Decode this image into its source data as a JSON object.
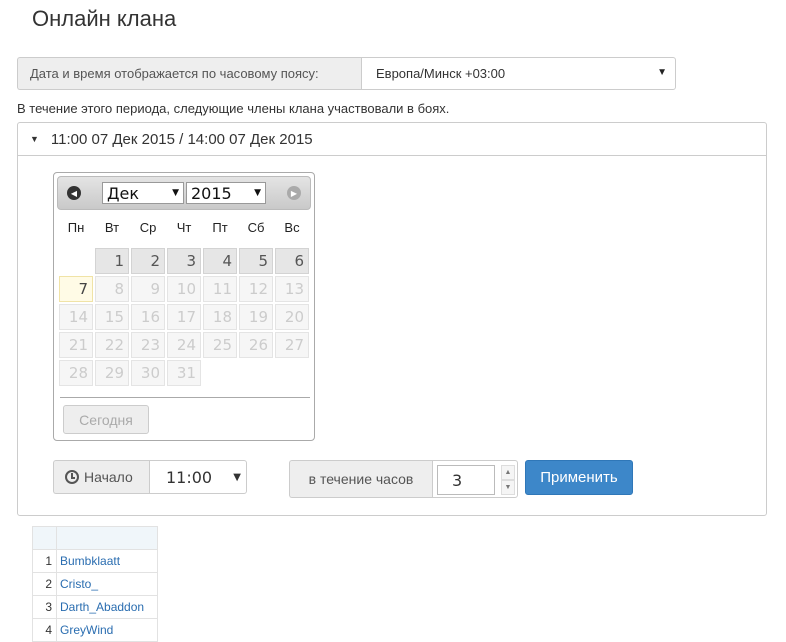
{
  "page": {
    "title": "Онлайн клана"
  },
  "timezone": {
    "label": "Дата и время отображается по часовому поясу:",
    "value": "Европа/Минск +03:00"
  },
  "period_text": "В течение этого периода, следующие члены клана участвовали в боях.",
  "panel": {
    "header": "11:00 07 Дек 2015 / 14:00 07 Дек 2015"
  },
  "datepicker": {
    "month": "Дек",
    "year": "2015",
    "weekdays": [
      "Пн",
      "Вт",
      "Ср",
      "Чт",
      "Пт",
      "Сб",
      "Вс"
    ],
    "today_button": "Сегодня",
    "days": [
      "",
      "1",
      "2",
      "3",
      "4",
      "5",
      "6",
      "7",
      "8",
      "9",
      "10",
      "11",
      "12",
      "13",
      "14",
      "15",
      "16",
      "17",
      "18",
      "19",
      "20",
      "21",
      "22",
      "23",
      "24",
      "25",
      "26",
      "27",
      "28",
      "29",
      "30",
      "31",
      "",
      "",
      ""
    ],
    "selectable_days": [
      "1",
      "2",
      "3",
      "4",
      "5",
      "6"
    ],
    "today_day": "7"
  },
  "start": {
    "label": "Начало",
    "value": "11:00"
  },
  "duration": {
    "label": "в течение часов",
    "value": "3"
  },
  "apply_button": "Применить",
  "members": [
    {
      "n": "1",
      "name": "Bumbklaatt"
    },
    {
      "n": "2",
      "name": "Cristo_"
    },
    {
      "n": "3",
      "name": "Darth_Abaddon"
    },
    {
      "n": "4",
      "name": "GreyWind"
    }
  ]
}
